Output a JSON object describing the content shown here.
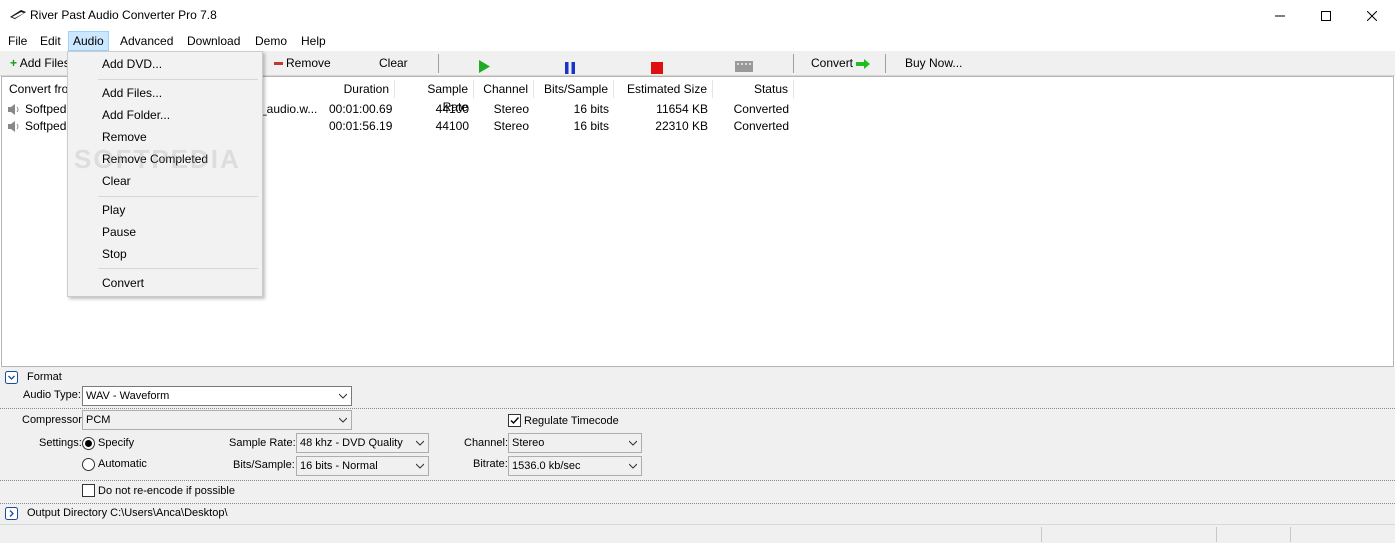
{
  "window": {
    "title": "River Past Audio Converter Pro 7.8"
  },
  "menubar": {
    "items": [
      "File",
      "Edit",
      "Audio",
      "Advanced",
      "Download",
      "Demo",
      "Help"
    ],
    "active": "Audio"
  },
  "toolbar": {
    "add_files": "Add Files",
    "remove": "Remove",
    "clear": "Clear",
    "convert": "Convert",
    "buy_now": "Buy Now..."
  },
  "audio_menu": {
    "items": [
      "Add DVD...",
      "Add Files...",
      "Add Folder...",
      "Remove",
      "Remove Completed",
      "Clear",
      "Play",
      "Pause",
      "Stop",
      "Convert"
    ]
  },
  "list": {
    "columns": [
      "Convert from",
      "Duration",
      "Sample Rate",
      "Channel",
      "Bits/Sample",
      "Estimated Size",
      "Status"
    ],
    "rows": [
      {
        "name": "Softpedia",
        "name_tail": "_audio.w...",
        "duration": "00:01:00.69",
        "sample_rate": "44100",
        "channel": "Stereo",
        "bits": "16 bits",
        "size": "11654 KB",
        "status": "Converted"
      },
      {
        "name": "Softpedia",
        "name_tail": "",
        "duration": "00:01:56.19",
        "sample_rate": "44100",
        "channel": "Stereo",
        "bits": "16 bits",
        "size": "22310 KB",
        "status": "Converted"
      }
    ]
  },
  "watermark": "SOFTPEDIA",
  "format_panel": {
    "header": "Format",
    "audio_type_label": "Audio Type:",
    "audio_type_value": "WAV - Waveform",
    "compressor_label": "Compressor:",
    "compressor_value": "PCM",
    "regulate_timecode": "Regulate Timecode",
    "settings_label": "Settings:",
    "specify": "Specify",
    "automatic": "Automatic",
    "sample_rate_label": "Sample Rate:",
    "sample_rate_value": "48 khz - DVD Quality",
    "bits_label": "Bits/Sample:",
    "bits_value": "16 bits - Normal",
    "channel_label": "Channel:",
    "channel_value": "Stereo",
    "bitrate_label": "Bitrate:",
    "bitrate_value": "1536.0 kb/sec",
    "no_reencode": "Do not re-encode if possible"
  },
  "output": {
    "label": "Output Directory C:\\Users\\Anca\\Desktop\\"
  },
  "colors": {
    "play": "#22aa22",
    "pause": "#1a33cc",
    "stop": "#dd1111",
    "menu_highlight": "#cce8ff"
  }
}
